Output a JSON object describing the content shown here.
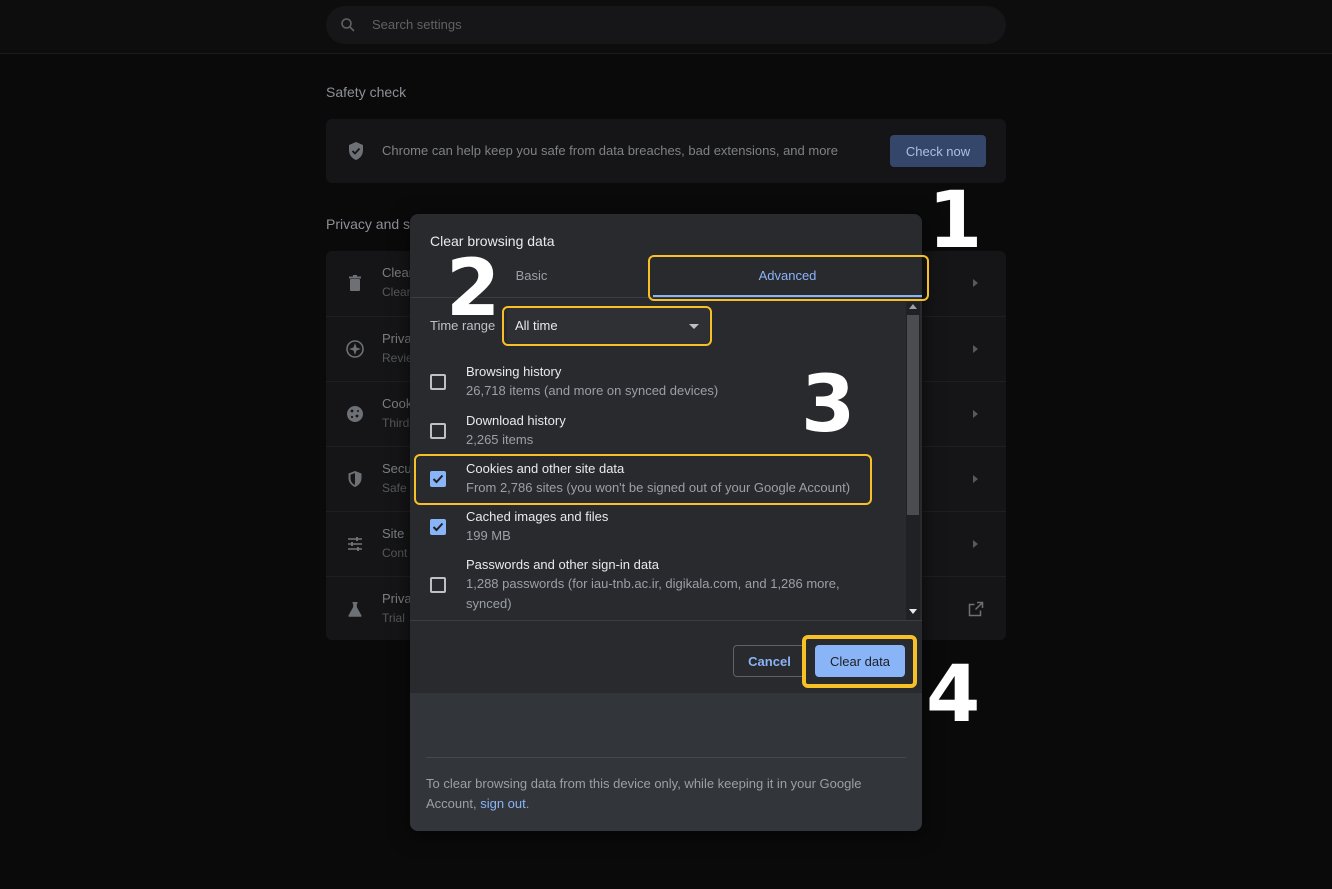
{
  "search": {
    "placeholder": "Search settings"
  },
  "safety_check": {
    "section_title": "Safety check",
    "description": "Chrome can help keep you safe from data breaches, bad extensions, and more",
    "button_label": "Check now"
  },
  "privacy": {
    "section_title": "Privacy and s",
    "rows": [
      {
        "title": "Clear",
        "sub": "Clear",
        "icon": "trash-icon"
      },
      {
        "title": "Priva",
        "sub": "Revie",
        "icon": "compass-icon"
      },
      {
        "title": "Cook",
        "sub": "Third",
        "icon": "cookie-icon"
      },
      {
        "title": "Secu",
        "sub": "Safe",
        "icon": "shield-icon"
      },
      {
        "title": "Site",
        "sub": "Cont",
        "icon": "sliders-icon"
      },
      {
        "title": "Priva",
        "sub": "Trial",
        "icon": "flask-icon"
      }
    ]
  },
  "dialog": {
    "title": "Clear browsing data",
    "tabs": {
      "basic": "Basic",
      "advanced": "Advanced"
    },
    "active_tab": "advanced",
    "time_range_label": "Time range",
    "time_range_value": "All time",
    "items": [
      {
        "title": "Browsing history",
        "sub": "26,718 items (and more on synced devices)",
        "checked": false
      },
      {
        "title": "Download history",
        "sub": "2,265 items",
        "checked": false
      },
      {
        "title": "Cookies and other site data",
        "sub": "From 2,786 sites (you won't be signed out of your Google Account)",
        "checked": true
      },
      {
        "title": "Cached images and files",
        "sub": "199 MB",
        "checked": true
      },
      {
        "title": "Passwords and other sign-in data",
        "sub": "1,288 passwords (for iau-tnb.ac.ir, digikala.com, and 1,286 more, synced)",
        "checked": false
      }
    ],
    "cancel_label": "Cancel",
    "clear_label": "Clear data",
    "footer_text": "To clear browsing data from this device only, while keeping it in your Google Account,",
    "footer_link": "sign out",
    "footer_period": "."
  },
  "annotations": {
    "step1": "1",
    "step2": "2",
    "step3": "3",
    "step4": "4"
  },
  "colors": {
    "accent": "#8ab4f8",
    "highlight": "#f6c026",
    "dialog_bg": "#292a2d"
  }
}
